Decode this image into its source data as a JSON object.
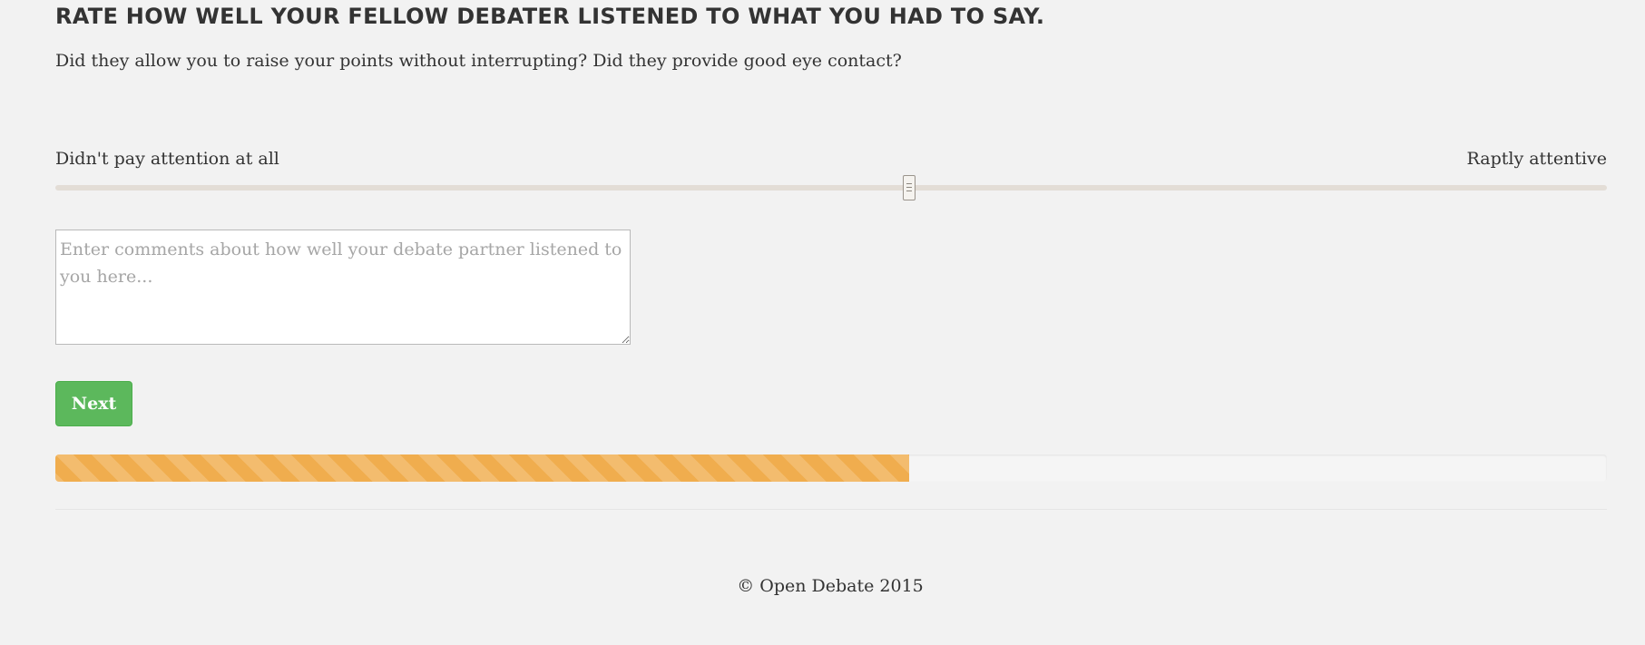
{
  "question": {
    "title": "RATE HOW WELL YOUR FELLOW DEBATER LISTENED TO WHAT YOU HAD TO SAY.",
    "description": "Did they allow you to raise your points without interrupting? Did they provide good eye contact?"
  },
  "rating_scale": {
    "min_label": "Didn't pay attention at all",
    "max_label": "Raptly attentive",
    "value_fraction": 0.55
  },
  "comments": {
    "value": "",
    "placeholder": "Enter comments about how well your debate partner listened to you here..."
  },
  "actions": {
    "next_label": "Next"
  },
  "progress": {
    "value_fraction": 0.55,
    "color": "#f0ad4e"
  },
  "footer": {
    "copyright": "© Open Debate 2015"
  },
  "colors": {
    "background": "#f2f2f2",
    "next_button": "#5cb85c",
    "text": "#333333"
  }
}
